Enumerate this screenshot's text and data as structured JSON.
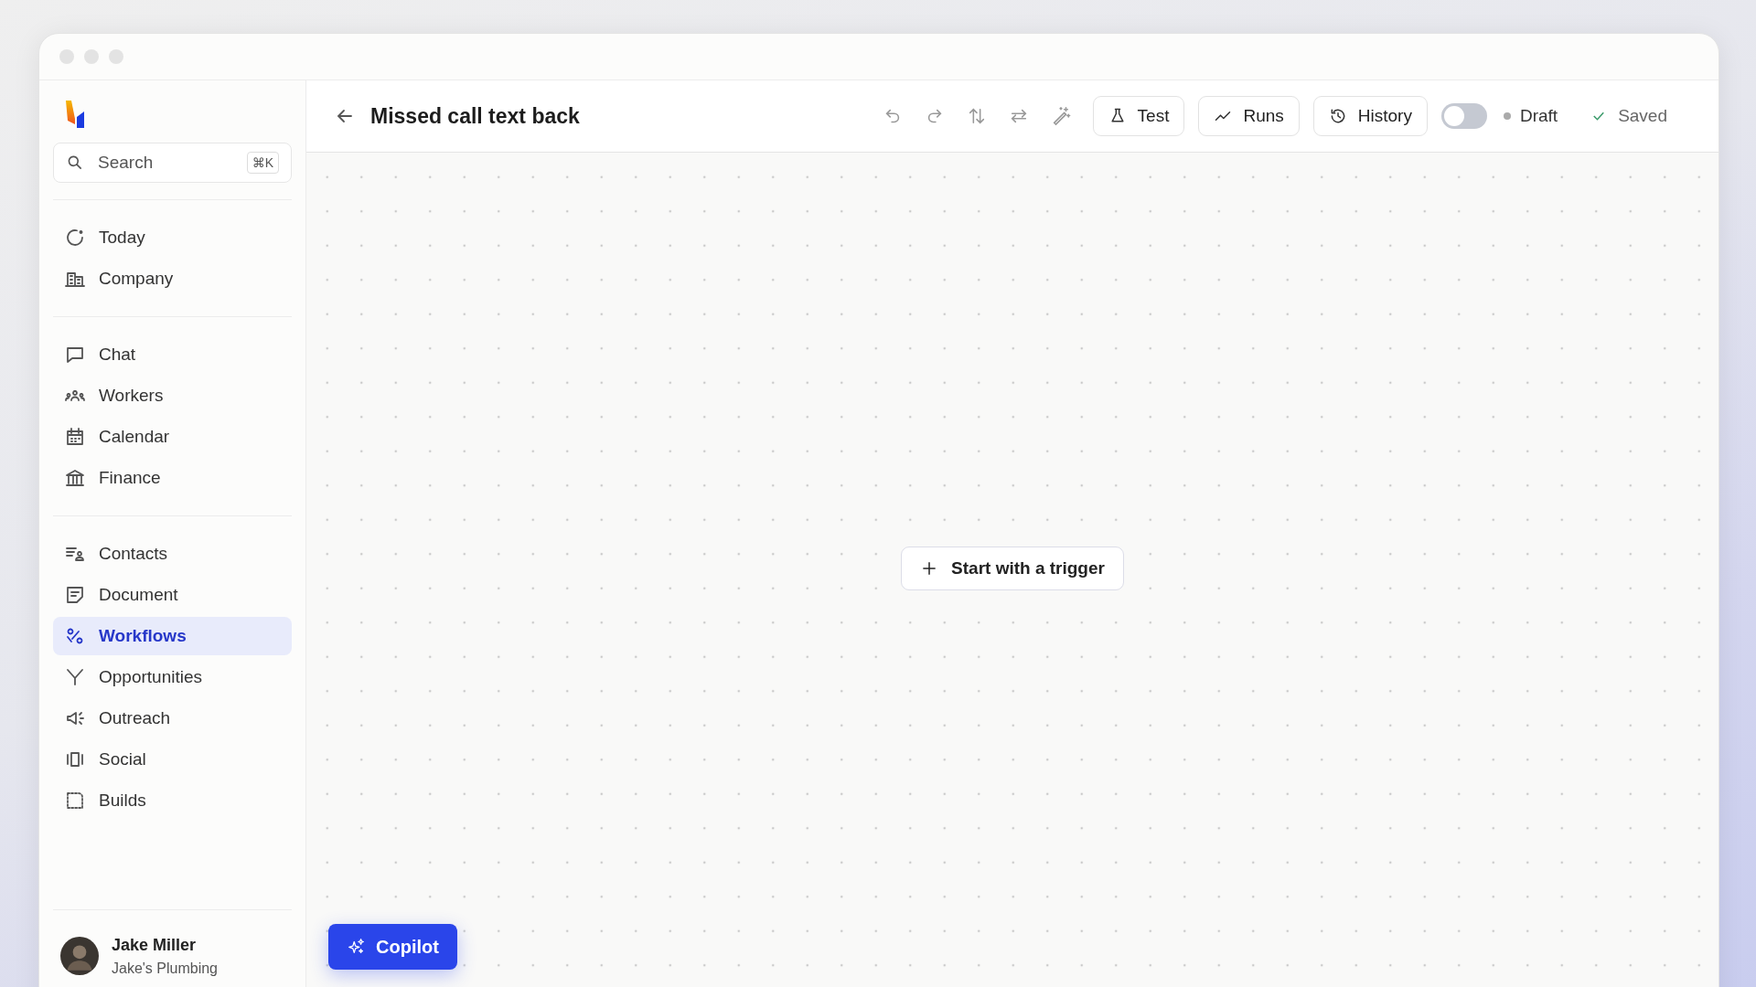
{
  "sidebar": {
    "search": {
      "placeholder": "Search",
      "shortcut": "⌘K"
    },
    "groups": [
      {
        "items": [
          {
            "label": "Today",
            "selected": false
          },
          {
            "label": "Company",
            "selected": false
          }
        ]
      },
      {
        "items": [
          {
            "label": "Chat",
            "selected": false
          },
          {
            "label": "Workers",
            "selected": false
          },
          {
            "label": "Calendar",
            "selected": false
          },
          {
            "label": "Finance",
            "selected": false
          }
        ]
      },
      {
        "items": [
          {
            "label": "Contacts",
            "selected": false
          },
          {
            "label": "Document",
            "selected": false
          },
          {
            "label": "Workflows",
            "selected": true
          },
          {
            "label": "Opportunities",
            "selected": false
          },
          {
            "label": "Outreach",
            "selected": false
          },
          {
            "label": "Social",
            "selected": false
          },
          {
            "label": "Builds",
            "selected": false
          }
        ]
      }
    ],
    "user": {
      "name": "Jake Miller",
      "company": "Jake's Plumbing"
    }
  },
  "header": {
    "title": "Missed call text back",
    "buttons": [
      {
        "label": "Test"
      },
      {
        "label": "Runs"
      },
      {
        "label": "History"
      }
    ],
    "toggle": {
      "on": false
    },
    "status": "Draft",
    "save_state": "Saved"
  },
  "canvas": {
    "start_button": "Start with a trigger",
    "copilot_button": "Copilot"
  }
}
